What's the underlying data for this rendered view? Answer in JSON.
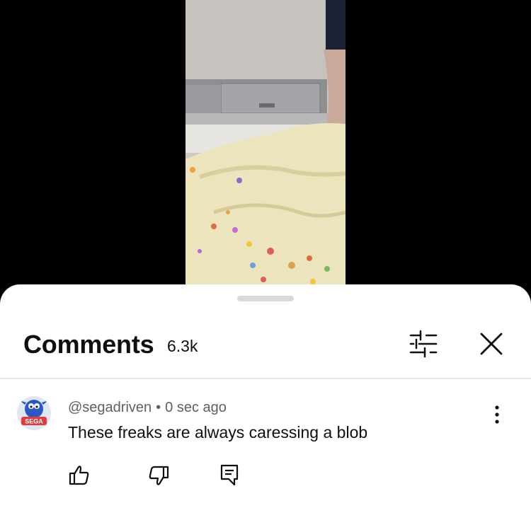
{
  "comments_panel": {
    "title": "Comments",
    "count": "6.3k",
    "icons": {
      "filter": "sliders-icon",
      "close": "close-icon"
    }
  },
  "comment": {
    "author": "@segadriven",
    "separator": "•",
    "time": "0 sec ago",
    "text": "These freaks are always caressing a blob",
    "avatar_badge": "SEGA",
    "icons": {
      "more": "more-vertical-icon",
      "like": "thumbs-up-icon",
      "dislike": "thumbs-down-icon",
      "reply": "reply-icon"
    }
  }
}
